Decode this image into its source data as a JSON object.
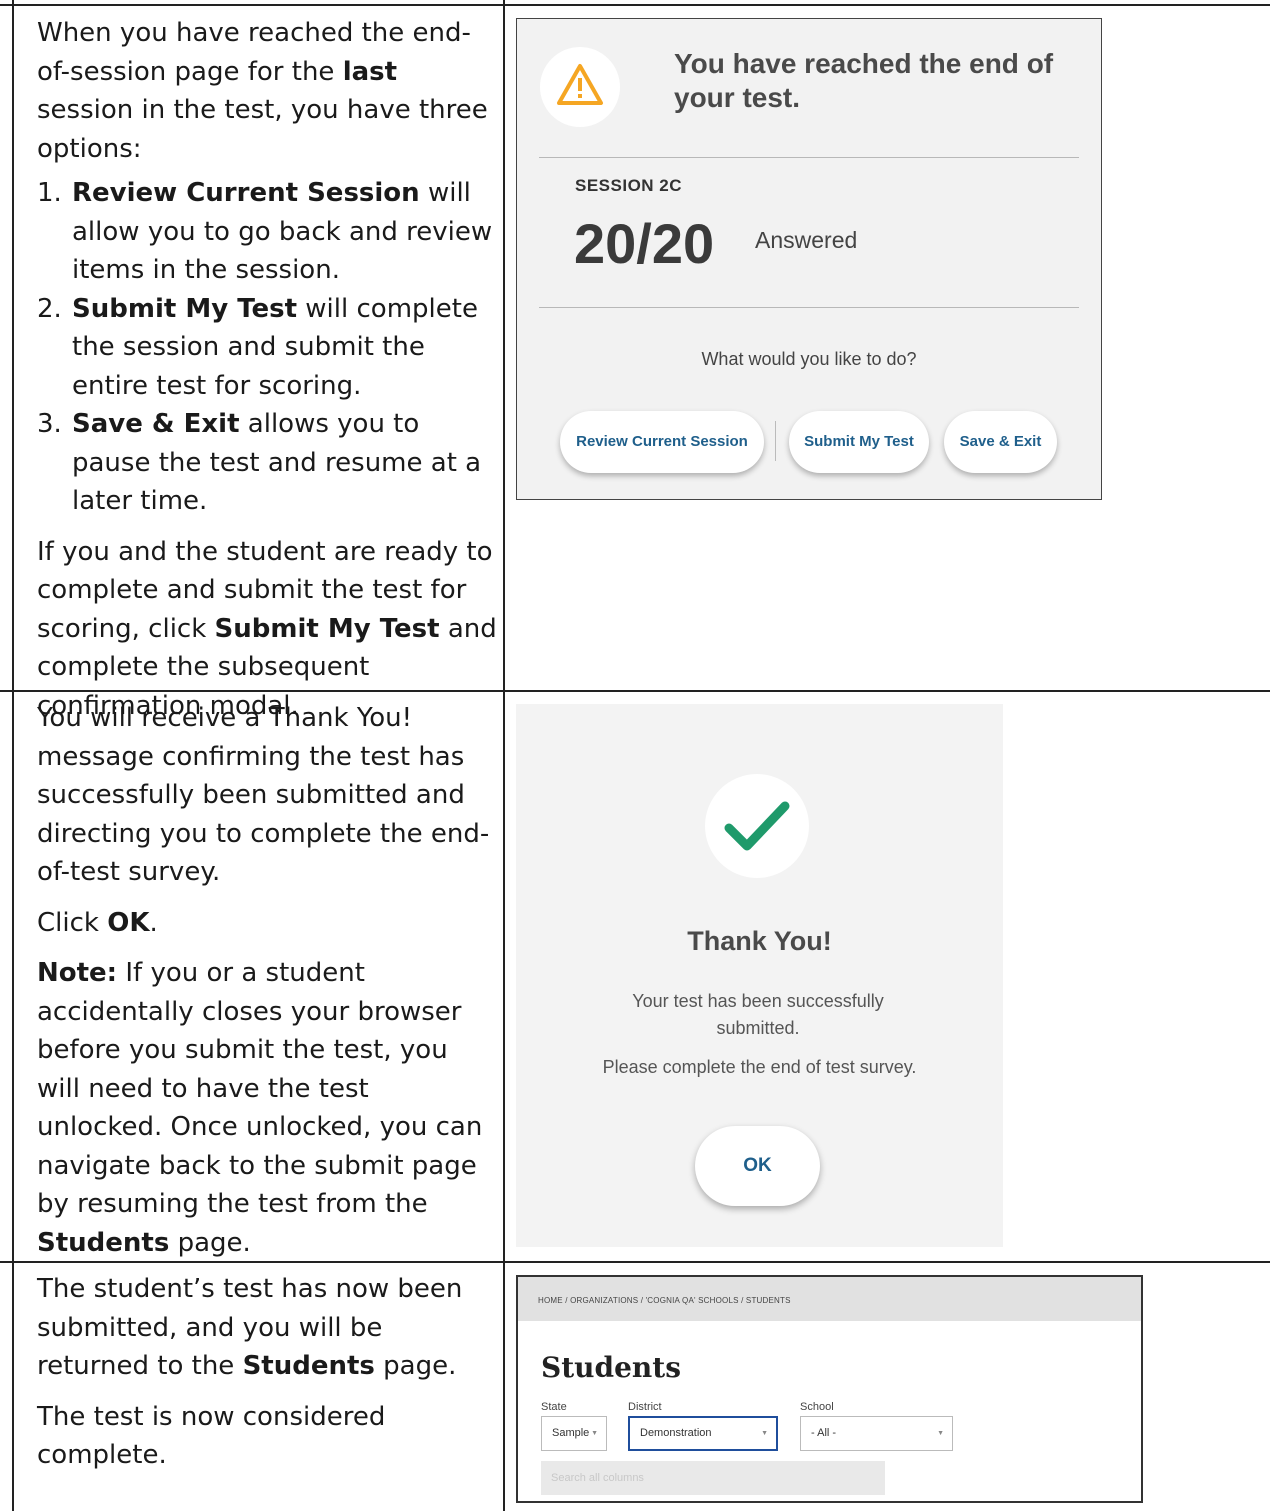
{
  "rows": [
    {
      "intro": "When you have reached the end-of-session page for the",
      "intro_bold": "last",
      "intro_end": "session in the test, you have three options:",
      "options": [
        {
          "num": "1.",
          "bold": "Review Current Session",
          "text": "will allow you to go back and review items in the session."
        },
        {
          "num": "2.",
          "bold": "Submit My Test",
          "text": "will complete the session and submit the entire test for scoring."
        },
        {
          "num": "3.",
          "bold": "Save & Exit",
          "text": "allows you to pause the test and resume at a later time."
        }
      ],
      "para_a": "If you and the student are ready to complete and submit the test for scoring, click",
      "para_bold": "Submit My Test",
      "para_b": "and complete the subsequent confirmation modal."
    },
    {
      "para1": "You will receive a Thank You! message confirming the test has successfully been submitted and directing you to complete the end-of-test survey.",
      "click_a": "Click",
      "click_bold": "OK",
      "click_b": ".",
      "note_label": "Note:",
      "note_text": "If you or a student accidentally closes your browser before you submit the test, you will need to have the test unlocked. Once unlocked, you can navigate back to the submit page by resuming the test from the",
      "note_bold": "Students",
      "note_end": "page."
    },
    {
      "para1_a": "The student’s test has now been submitted, and you will be returned to the",
      "para1_bold": "Students",
      "para1_b": "page.",
      "para2": "The test is now considered complete."
    }
  ],
  "panel1": {
    "heading": "You have reached the end of your test.",
    "session_label": "SESSION 2C",
    "count": "20/20",
    "status": "Answered",
    "question": "What would you like to do?",
    "buttons": {
      "review": "Review Current Session",
      "submit": "Submit My Test",
      "save": "Save & Exit"
    },
    "warning_color": "#f5a623"
  },
  "panel2": {
    "title": "Thank You!",
    "message": "Your test has been successfully submitted.",
    "survey": "Please complete the end of test survey.",
    "ok_label": "OK",
    "check_color": "#1f9a6b"
  },
  "panel3": {
    "breadcrumb": "HOME  /  ORGANIZATIONS  /  'COGNIA QA' SCHOOLS  /  STUDENTS",
    "title": "Students",
    "filters": {
      "state": {
        "label": "State",
        "value": "Sample"
      },
      "district": {
        "label": "District",
        "value": "Demonstration"
      },
      "school": {
        "label": "School",
        "value": "- All -"
      }
    },
    "search_placeholder": "Search all columns"
  }
}
